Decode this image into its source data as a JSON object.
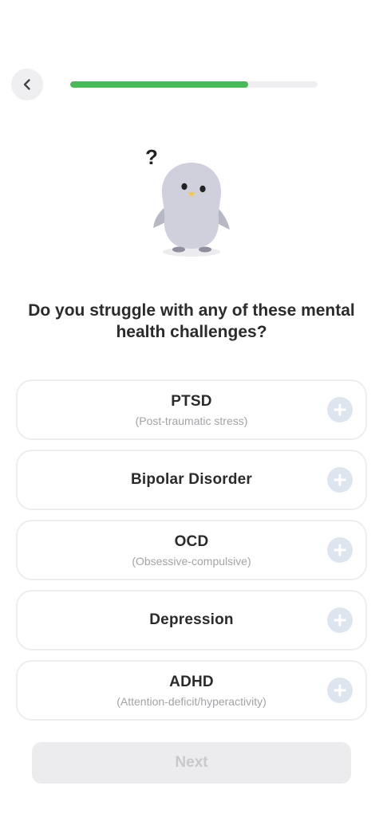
{
  "progress": {
    "fraction": 0.72,
    "color": "#4cb857"
  },
  "header": {
    "back_icon": "chevron-left-icon"
  },
  "mascot": {
    "question_mark": "?",
    "body_color": "#cfd0dc",
    "beak_color": "#f2c94c"
  },
  "question": "Do you struggle with any of these mental health challenges?",
  "options": [
    {
      "title": "PTSD",
      "subtitle": "(Post-traumatic stress)"
    },
    {
      "title": "Bipolar Disorder",
      "subtitle": ""
    },
    {
      "title": "OCD",
      "subtitle": "(Obsessive-compulsive)"
    },
    {
      "title": "Depression",
      "subtitle": ""
    },
    {
      "title": "ADHD",
      "subtitle": "(Attention-deficit/hyperactivity)"
    }
  ],
  "next_button": {
    "label": "Next",
    "enabled": false
  }
}
